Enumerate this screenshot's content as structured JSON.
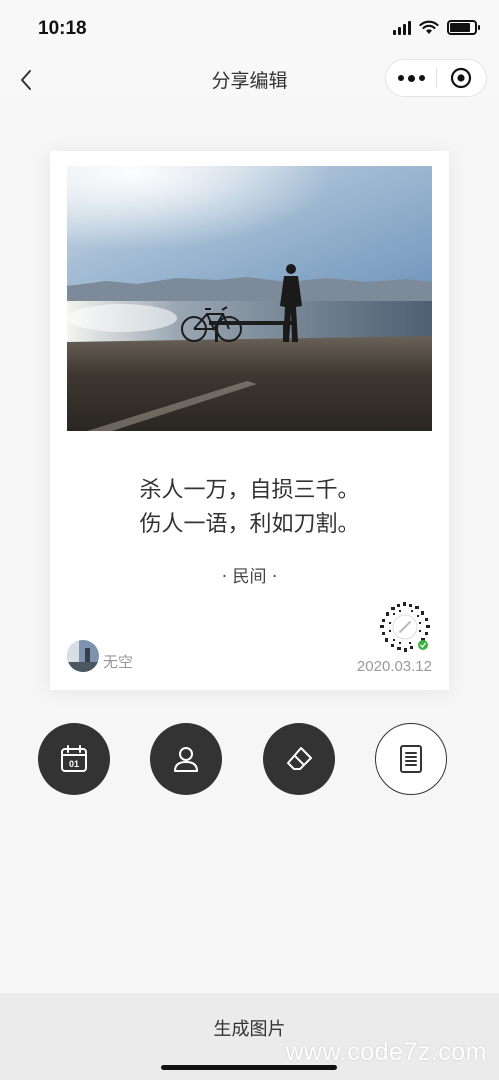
{
  "status_bar": {
    "time": "10:18",
    "battery_level": 0.85
  },
  "nav": {
    "title": "分享编辑",
    "back_icon": "chevron-left-icon",
    "more_icon": "more-dots-icon",
    "close_icon": "target-close-icon"
  },
  "card": {
    "photo": "seaside-man-with-bicycle",
    "quote_lines": [
      "杀人一万，自损三千。",
      "伤人一语，利如刀割。"
    ],
    "source": "· 民间 ·",
    "author": "无空",
    "date": "2020.03.12",
    "qr_icon": "mini-program-code-icon"
  },
  "tools": [
    {
      "name": "date",
      "icon": "calendar-icon",
      "icon_text": "01"
    },
    {
      "name": "author",
      "icon": "user-icon"
    },
    {
      "name": "clear",
      "icon": "eraser-icon"
    },
    {
      "name": "text",
      "icon": "document-icon"
    }
  ],
  "bottom": {
    "generate_label": "生成图片"
  },
  "watermark": "www.code7z.com",
  "colors": {
    "dark": "#333333",
    "bg": "#f6f6f6",
    "card": "#ffffff",
    "muted": "#999999"
  }
}
